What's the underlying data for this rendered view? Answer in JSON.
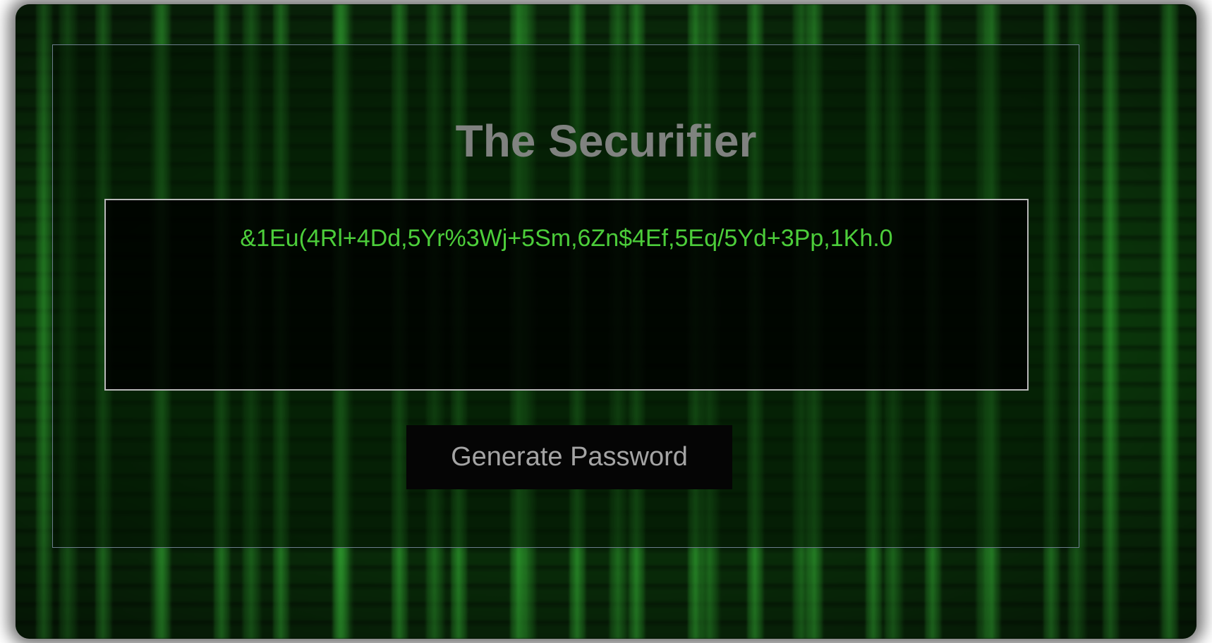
{
  "page": {
    "title": "The Securifier"
  },
  "password": {
    "value": "&1Eu(4Rl+4Dd,5Yr%3Wj+5Sm,6Zn$4Ef,5Eq/5Yd+3Pp,1Kh.0",
    "placeholder": ""
  },
  "actions": {
    "generate_label": "Generate Password"
  },
  "colors": {
    "password_text": "#4ccd3a",
    "title_text": "#8a8a8a",
    "button_background": "#050505",
    "button_text": "#a4a4a4",
    "box_border": "#b9b9b9"
  }
}
